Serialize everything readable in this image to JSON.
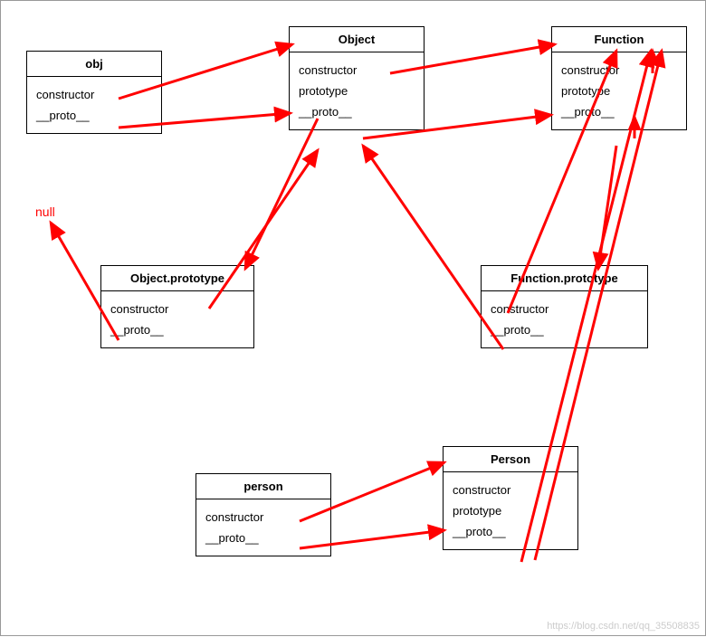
{
  "nullLabel": "null",
  "watermark": "https://blog.csdn.net/qq_35508835",
  "boxes": {
    "obj": {
      "title": "obj",
      "prop1": "constructor",
      "prop2": "__proto__"
    },
    "Object": {
      "title": "Object",
      "prop1": "constructor",
      "prop2": "prototype",
      "prop3": "__proto__"
    },
    "Function": {
      "title": "Function",
      "prop1": "constructor",
      "prop2": "prototype",
      "prop3": "__proto__"
    },
    "ObjectPrototype": {
      "title": "Object.prototype",
      "prop1": "constructor",
      "prop2": "__proto__"
    },
    "FunctionPrototype": {
      "title": "Function.prototype",
      "prop1": "constructor",
      "prop2": "__proto__"
    },
    "person": {
      "title": "person",
      "prop1": "constructor",
      "prop2": "__proto__"
    },
    "Person": {
      "title": "Person",
      "prop1": "constructor",
      "prop2": "prototype",
      "prop3": "__proto__"
    }
  },
  "chart_data": {
    "type": "table",
    "description": "JavaScript prototype chain diagram",
    "nodes": [
      {
        "id": "obj",
        "props": [
          "constructor",
          "__proto__"
        ]
      },
      {
        "id": "Object",
        "props": [
          "constructor",
          "prototype",
          "__proto__"
        ]
      },
      {
        "id": "Function",
        "props": [
          "constructor",
          "prototype",
          "__proto__"
        ]
      },
      {
        "id": "Object.prototype",
        "props": [
          "constructor",
          "__proto__"
        ]
      },
      {
        "id": "Function.prototype",
        "props": [
          "constructor",
          "__proto__"
        ]
      },
      {
        "id": "person",
        "props": [
          "constructor",
          "__proto__"
        ]
      },
      {
        "id": "Person",
        "props": [
          "constructor",
          "prototype",
          "__proto__"
        ]
      },
      {
        "id": "null",
        "props": []
      }
    ],
    "edges": [
      {
        "from": "obj",
        "prop": "constructor",
        "to": "Object"
      },
      {
        "from": "obj",
        "prop": "__proto__",
        "to": "Object.prototype"
      },
      {
        "from": "Object",
        "prop": "constructor",
        "to": "Function"
      },
      {
        "from": "Object",
        "prop": "prototype",
        "to": "Object.prototype"
      },
      {
        "from": "Object",
        "prop": "__proto__",
        "to": "Function.prototype"
      },
      {
        "from": "Function",
        "prop": "constructor",
        "to": "Function"
      },
      {
        "from": "Function",
        "prop": "prototype",
        "to": "Function.prototype"
      },
      {
        "from": "Function",
        "prop": "__proto__",
        "to": "Function.prototype"
      },
      {
        "from": "Object.prototype",
        "prop": "constructor",
        "to": "Object"
      },
      {
        "from": "Object.prototype",
        "prop": "__proto__",
        "to": "null"
      },
      {
        "from": "Function.prototype",
        "prop": "constructor",
        "to": "Function"
      },
      {
        "from": "Function.prototype",
        "prop": "__proto__",
        "to": "Object.prototype"
      },
      {
        "from": "person",
        "prop": "constructor",
        "to": "Person"
      },
      {
        "from": "person",
        "prop": "__proto__",
        "to": "Person.prototype"
      },
      {
        "from": "Person",
        "prop": "__proto__",
        "to": "Function.prototype"
      }
    ]
  }
}
